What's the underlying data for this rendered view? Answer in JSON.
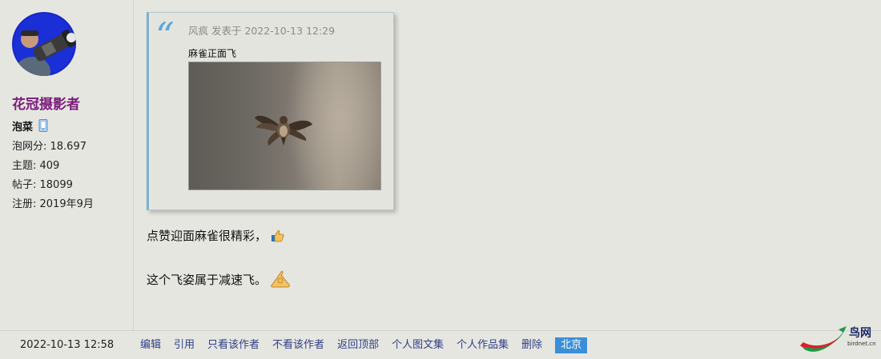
{
  "user": {
    "name": "花冠摄影者",
    "rank": "泡菜",
    "score": "泡网分: 18.697",
    "topics": "主题: 409",
    "posts": "帖子: 18099",
    "registered": "注册: 2019年9月",
    "device_icon": "mobile-phone-icon"
  },
  "quote": {
    "author_line": "风疯 发表于 2022-10-13 12:29",
    "text": "麻雀正面飞",
    "photo_subject": "flying-sparrow-photo"
  },
  "reply": {
    "line1": "点赞迎面麻雀很精彩，",
    "line2": "这个飞姿属于减速飞。",
    "emoji1": "thumbs-up-icon",
    "emoji2": "ok-hand-icon"
  },
  "footer": {
    "post_time": "2022-10-13 12:58",
    "actions": [
      "编辑",
      "引用",
      "只看该作者",
      "不看该作者",
      "返回顶部",
      "个人图文集",
      "个人作品集",
      "删除"
    ],
    "location": "北京"
  },
  "logo": {
    "name": "鸟网",
    "url": "birdnet.cn"
  },
  "colors": {
    "username": "#7a1c7a",
    "link": "#2e3f87",
    "badge": "#3b8fd8",
    "quote_mark": "#5aa6dd",
    "background": "#e6e6e1"
  }
}
